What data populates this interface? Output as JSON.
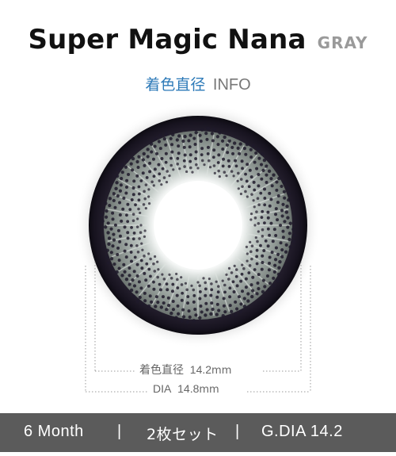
{
  "header": {
    "product_name": "Super Magic Nana",
    "color_name": "GRAY",
    "subtitle_jp": "着色直径",
    "subtitle_en": "INFO"
  },
  "dimensions": {
    "colored_label": "着色直径",
    "colored_value": "14.2",
    "dia_label": "DIA",
    "dia_value": "14.8",
    "unit": "mm"
  },
  "footer": {
    "duration": "6 Month",
    "separator": "|",
    "pack": "2枚セット",
    "gdia": "G.DIA 14.2"
  },
  "colors": {
    "lens_ring": "#1c1726",
    "lens_iris": "#9aa39f",
    "footer_bg": "#5b5b5b",
    "accent_blue": "#2d7ab8"
  }
}
